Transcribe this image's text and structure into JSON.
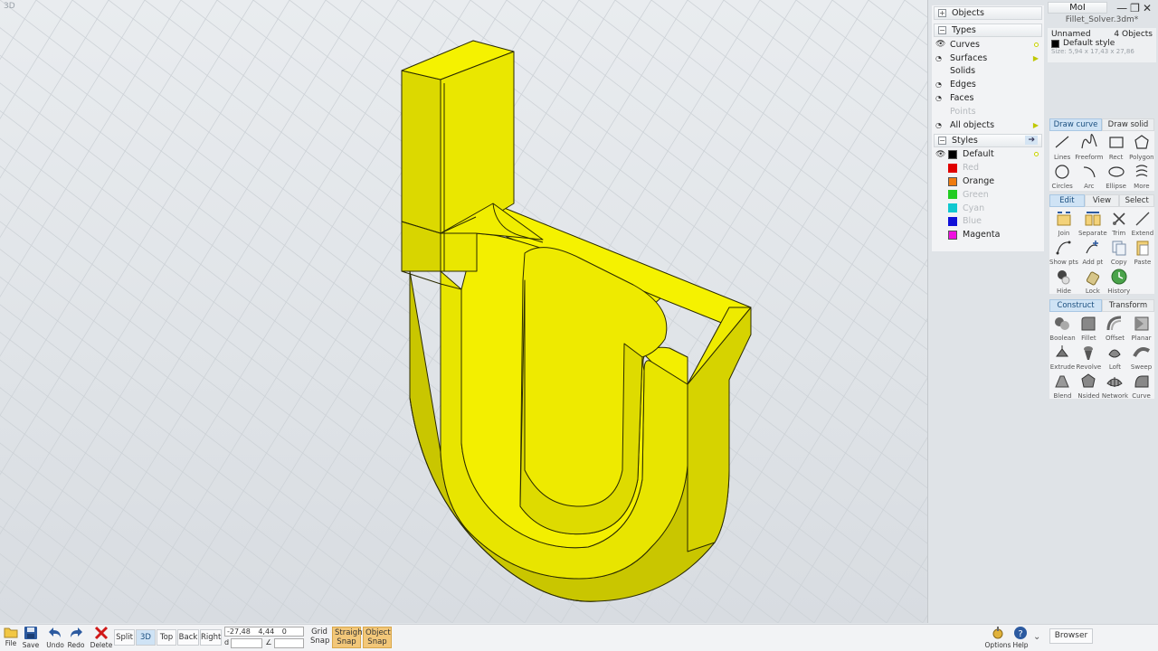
{
  "viewport": {
    "label": "3D"
  },
  "scene": {
    "objects_header": "Objects",
    "types_header": "Types",
    "types": [
      {
        "label": "Curves",
        "dim": false,
        "eye": true,
        "marker": "dot"
      },
      {
        "label": "Surfaces",
        "dim": false,
        "eye": false,
        "marker": "arrow"
      },
      {
        "label": "Solids",
        "dim": false,
        "eye": false,
        "marker": ""
      },
      {
        "label": "Edges",
        "dim": false,
        "eye": false,
        "marker": ""
      },
      {
        "label": "Faces",
        "dim": false,
        "eye": false,
        "marker": ""
      },
      {
        "label": "Points",
        "dim": true,
        "eye": false,
        "marker": ""
      },
      {
        "label": "All objects",
        "dim": false,
        "eye": false,
        "marker": "arrow"
      }
    ],
    "styles_header": "Styles",
    "styles": [
      {
        "label": "Default",
        "color": "#000000",
        "dim": false
      },
      {
        "label": "Red",
        "color": "#e00000",
        "dim": true
      },
      {
        "label": "Orange",
        "color": "#f07c10",
        "dim": false
      },
      {
        "label": "Green",
        "color": "#22cc22",
        "dim": true
      },
      {
        "label": "Cyan",
        "color": "#10c8d0",
        "dim": true
      },
      {
        "label": "Blue",
        "color": "#1010d8",
        "dim": true
      },
      {
        "label": "Magenta",
        "color": "#f010e0",
        "dim": false
      }
    ]
  },
  "props": {
    "app_name": "MoI",
    "filename": "Fillet_Solver.3dm*",
    "object_name": "Unnamed",
    "object_count": "4 Objects",
    "style": "Default style",
    "size": "Size: 5,94 x 17,43 x 27,86"
  },
  "draw": {
    "tabs": [
      "Draw curve",
      "Draw solid"
    ],
    "tools": [
      {
        "label": "Lines",
        "icon": "lines-icon"
      },
      {
        "label": "Freeform",
        "icon": "freeform-icon"
      },
      {
        "label": "Rect",
        "icon": "rect-icon"
      },
      {
        "label": "Polygon",
        "icon": "polygon-icon"
      },
      {
        "label": "Circles",
        "icon": "circles-icon"
      },
      {
        "label": "Arc",
        "icon": "arc-icon"
      },
      {
        "label": "Ellipse",
        "icon": "ellipse-icon"
      },
      {
        "label": "More",
        "icon": "more-icon"
      }
    ]
  },
  "edit": {
    "tabs": [
      "Edit",
      "View",
      "Select"
    ],
    "tools": [
      {
        "label": "Join",
        "icon": "join-icon"
      },
      {
        "label": "Separate",
        "icon": "separate-icon"
      },
      {
        "label": "Trim",
        "icon": "trim-icon"
      },
      {
        "label": "Extend",
        "icon": "extend-icon"
      },
      {
        "label": "Show pts",
        "icon": "show-points-icon"
      },
      {
        "label": "Add pt",
        "icon": "add-point-icon"
      },
      {
        "label": "Copy",
        "icon": "copy-icon"
      },
      {
        "label": "Paste",
        "icon": "paste-icon"
      },
      {
        "label": "Hide",
        "icon": "hide-icon"
      },
      {
        "label": "Lock",
        "icon": "lock-icon"
      },
      {
        "label": "History",
        "icon": "history-icon"
      }
    ]
  },
  "construct": {
    "tabs": [
      "Construct",
      "Transform"
    ],
    "tools": [
      {
        "label": "Boolean",
        "icon": "boolean-icon"
      },
      {
        "label": "Fillet",
        "icon": "fillet-icon"
      },
      {
        "label": "Offset",
        "icon": "offset-icon"
      },
      {
        "label": "Planar",
        "icon": "planar-icon"
      },
      {
        "label": "Extrude",
        "icon": "extrude-icon"
      },
      {
        "label": "Revolve",
        "icon": "revolve-icon"
      },
      {
        "label": "Loft",
        "icon": "loft-icon"
      },
      {
        "label": "Sweep",
        "icon": "sweep-icon"
      },
      {
        "label": "Blend",
        "icon": "blend-icon"
      },
      {
        "label": "Nsided",
        "icon": "nsided-icon"
      },
      {
        "label": "Network",
        "icon": "network-icon"
      },
      {
        "label": "Curve",
        "icon": "curve-icon"
      }
    ]
  },
  "bottom": {
    "file": "File",
    "save": "Save",
    "undo": "Undo",
    "redo": "Redo",
    "delete": "Delete",
    "views": [
      "Split",
      "3D",
      "Top",
      "Back",
      "Right"
    ],
    "active_view": "3D",
    "coord_x": "-27,48",
    "coord_y": "4,44",
    "coord_z": "0",
    "d_label": "d",
    "angle_label": "∠",
    "grid_snap": "Grid Snap",
    "straight_snap": "Straight Snap",
    "object_snap": "Object Snap",
    "options": "Options",
    "help": "Help",
    "browser": "Browser"
  },
  "colors": {
    "model": "#dada00",
    "accent_tab": "#cfe3f5",
    "snap_on": "#f2c779"
  }
}
